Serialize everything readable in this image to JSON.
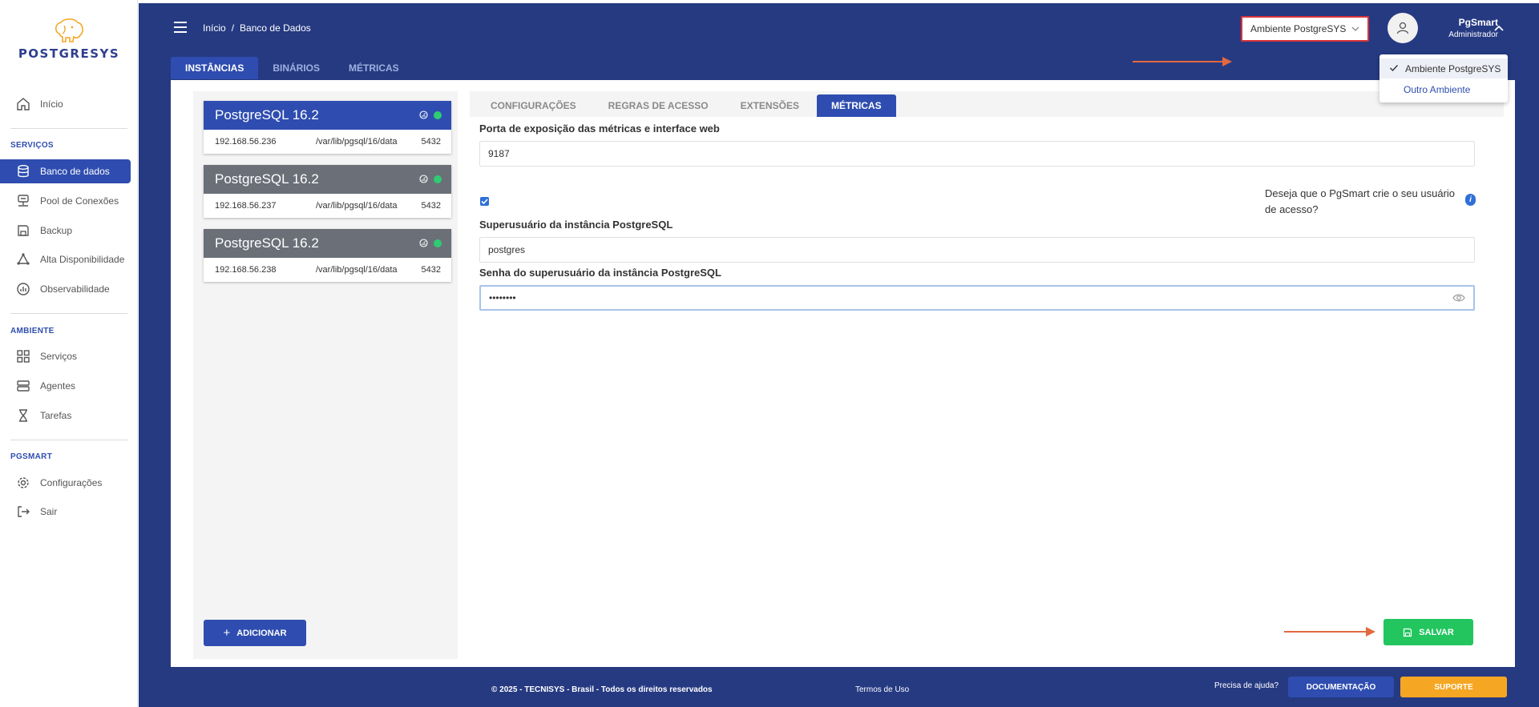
{
  "brand": {
    "name": "POSTGRESYS"
  },
  "sidebar": {
    "home": "Início",
    "sections": {
      "servicos": "SERVIÇOS",
      "ambiente": "AMBIENTE",
      "pgsmart": "PGSMART"
    },
    "servicos_items": [
      "Banco de dados",
      "Pool de Conexões",
      "Backup",
      "Alta Disponibilidade",
      "Observabilidade"
    ],
    "ambiente_items": [
      "Serviços",
      "Agentes",
      "Tarefas"
    ],
    "pgsmart_items": [
      "Configurações",
      "Sair"
    ]
  },
  "header": {
    "breadcrumb": [
      "Início",
      "/",
      "Banco de Dados"
    ],
    "environment": "Ambiente PostgreSYS",
    "environment_options": [
      "Ambiente PostgreSYS",
      "Outro Ambiente"
    ],
    "user_name": "PgSmart",
    "user_role": "Administrador"
  },
  "main_tabs": [
    "INSTÂNCIAS",
    "BINÁRIOS",
    "MÉTRICAS"
  ],
  "instances": [
    {
      "title": "PostgreSQL 16.2",
      "ip": "192.168.56.236",
      "path": "/var/lib/pgsql/16/data",
      "port": "5432"
    },
    {
      "title": "PostgreSQL 16.2",
      "ip": "192.168.56.237",
      "path": "/var/lib/pgsql/16/data",
      "port": "5432"
    },
    {
      "title": "PostgreSQL 16.2",
      "ip": "192.168.56.238",
      "path": "/var/lib/pgsql/16/data",
      "port": "5432"
    }
  ],
  "add_button": "ADICIONAR",
  "sub_tabs": [
    "CONFIGURAÇÕES",
    "REGRAS DE ACESSO",
    "EXTENSÕES",
    "MÉTRICAS"
  ],
  "form": {
    "port_label": "Porta de exposição das métricas e interface web",
    "port_value": "9187",
    "create_user_question": "Deseja que o PgSmart crie o seu usuário de acesso?",
    "superuser_label": "Superusuário da instância PostgreSQL",
    "superuser_value": "postgres",
    "password_label": "Senha do superusuário da instância PostgreSQL",
    "password_value": "••••••••",
    "save_button": "SALVAR"
  },
  "footer": {
    "copyright": "© 2025 - TECNISYS - Brasil - Todos os direitos reservados",
    "terms": "Termos de Uso",
    "help": "Precisa de ajuda?",
    "docs_button": "DOCUMENTAÇÃO",
    "support_button": "SUPORTE"
  },
  "colors": {
    "primary": "#2f4db0",
    "navy": "#263a82",
    "success": "#22c55e",
    "warning": "#f5a623",
    "annotation": "#e2693f"
  }
}
